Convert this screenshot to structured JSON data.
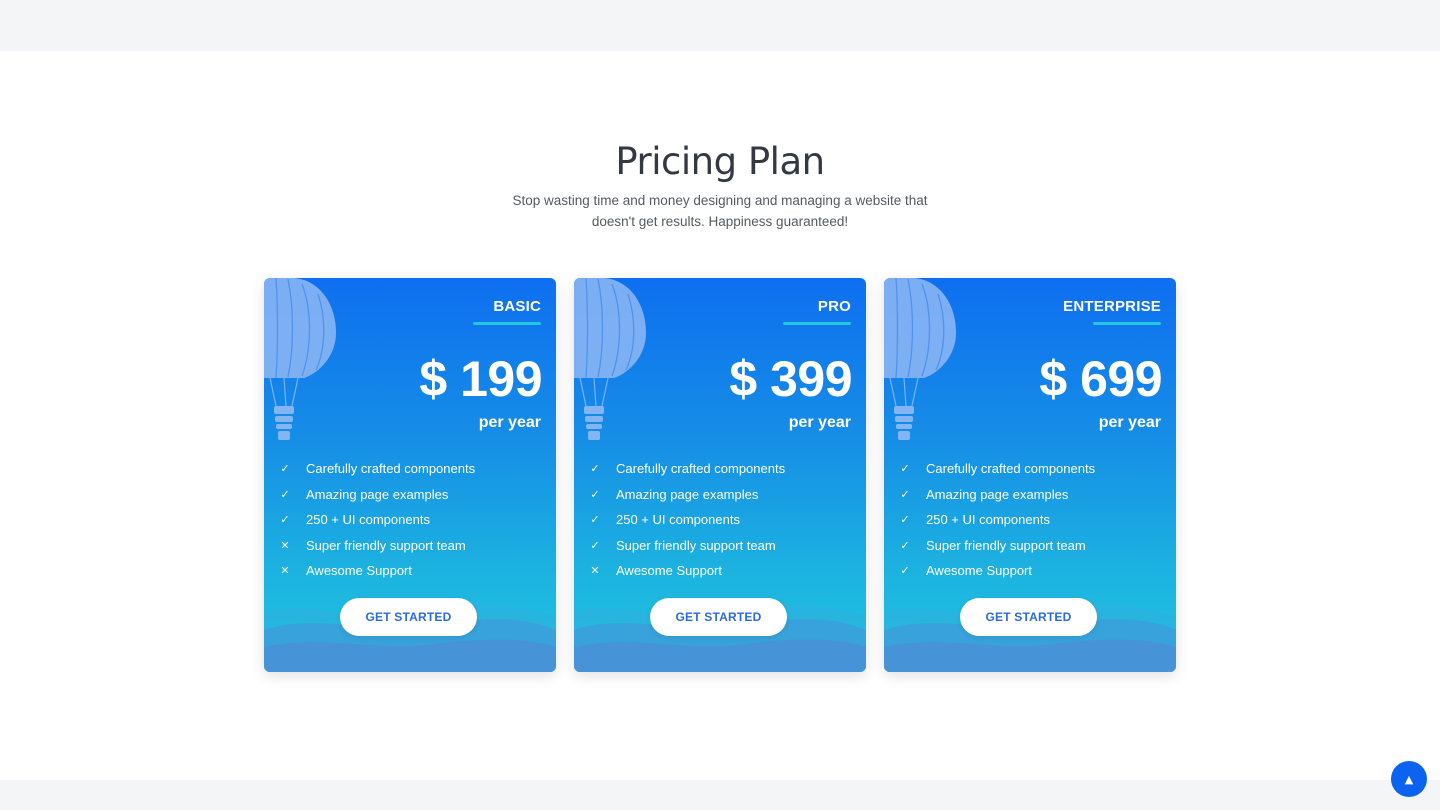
{
  "section": {
    "title": "Pricing Plan",
    "subtitle": "Stop wasting time and money designing and managing a website that doesn't get results. Happiness guaranteed!"
  },
  "plans": [
    {
      "name": "BASIC",
      "price": "$ 199",
      "period": "per year",
      "cta": "GET STARTED",
      "features": [
        {
          "text": "Carefully crafted components",
          "included": true
        },
        {
          "text": "Amazing page examples",
          "included": true
        },
        {
          "text": "250 + UI components",
          "included": true
        },
        {
          "text": "Super friendly support team",
          "included": false
        },
        {
          "text": "Awesome Support",
          "included": false
        }
      ]
    },
    {
      "name": "PRO",
      "price": "$ 399",
      "period": "per year",
      "cta": "GET STARTED",
      "features": [
        {
          "text": "Carefully crafted components",
          "included": true
        },
        {
          "text": "Amazing page examples",
          "included": true
        },
        {
          "text": "250 + UI components",
          "included": true
        },
        {
          "text": "Super friendly support team",
          "included": true
        },
        {
          "text": "Awesome Support",
          "included": false
        }
      ]
    },
    {
      "name": "ENTERPRISE",
      "price": "$ 699",
      "period": "per year",
      "cta": "GET STARTED",
      "features": [
        {
          "text": "Carefully crafted components",
          "included": true
        },
        {
          "text": "Amazing page examples",
          "included": true
        },
        {
          "text": "250 + UI components",
          "included": true
        },
        {
          "text": "Super friendly support team",
          "included": true
        },
        {
          "text": "Awesome Support",
          "included": true
        }
      ]
    }
  ],
  "icons": {
    "included": "check-icon",
    "excluded": "cross-icon",
    "scroll_top": "chevron-up-icon"
  },
  "colors": {
    "card_top": "#0e6ff0",
    "card_bottom": "#20c4df",
    "button_text": "#2a6bde",
    "underline": "#22c9dd",
    "scroll_button": "#0b63ef"
  }
}
